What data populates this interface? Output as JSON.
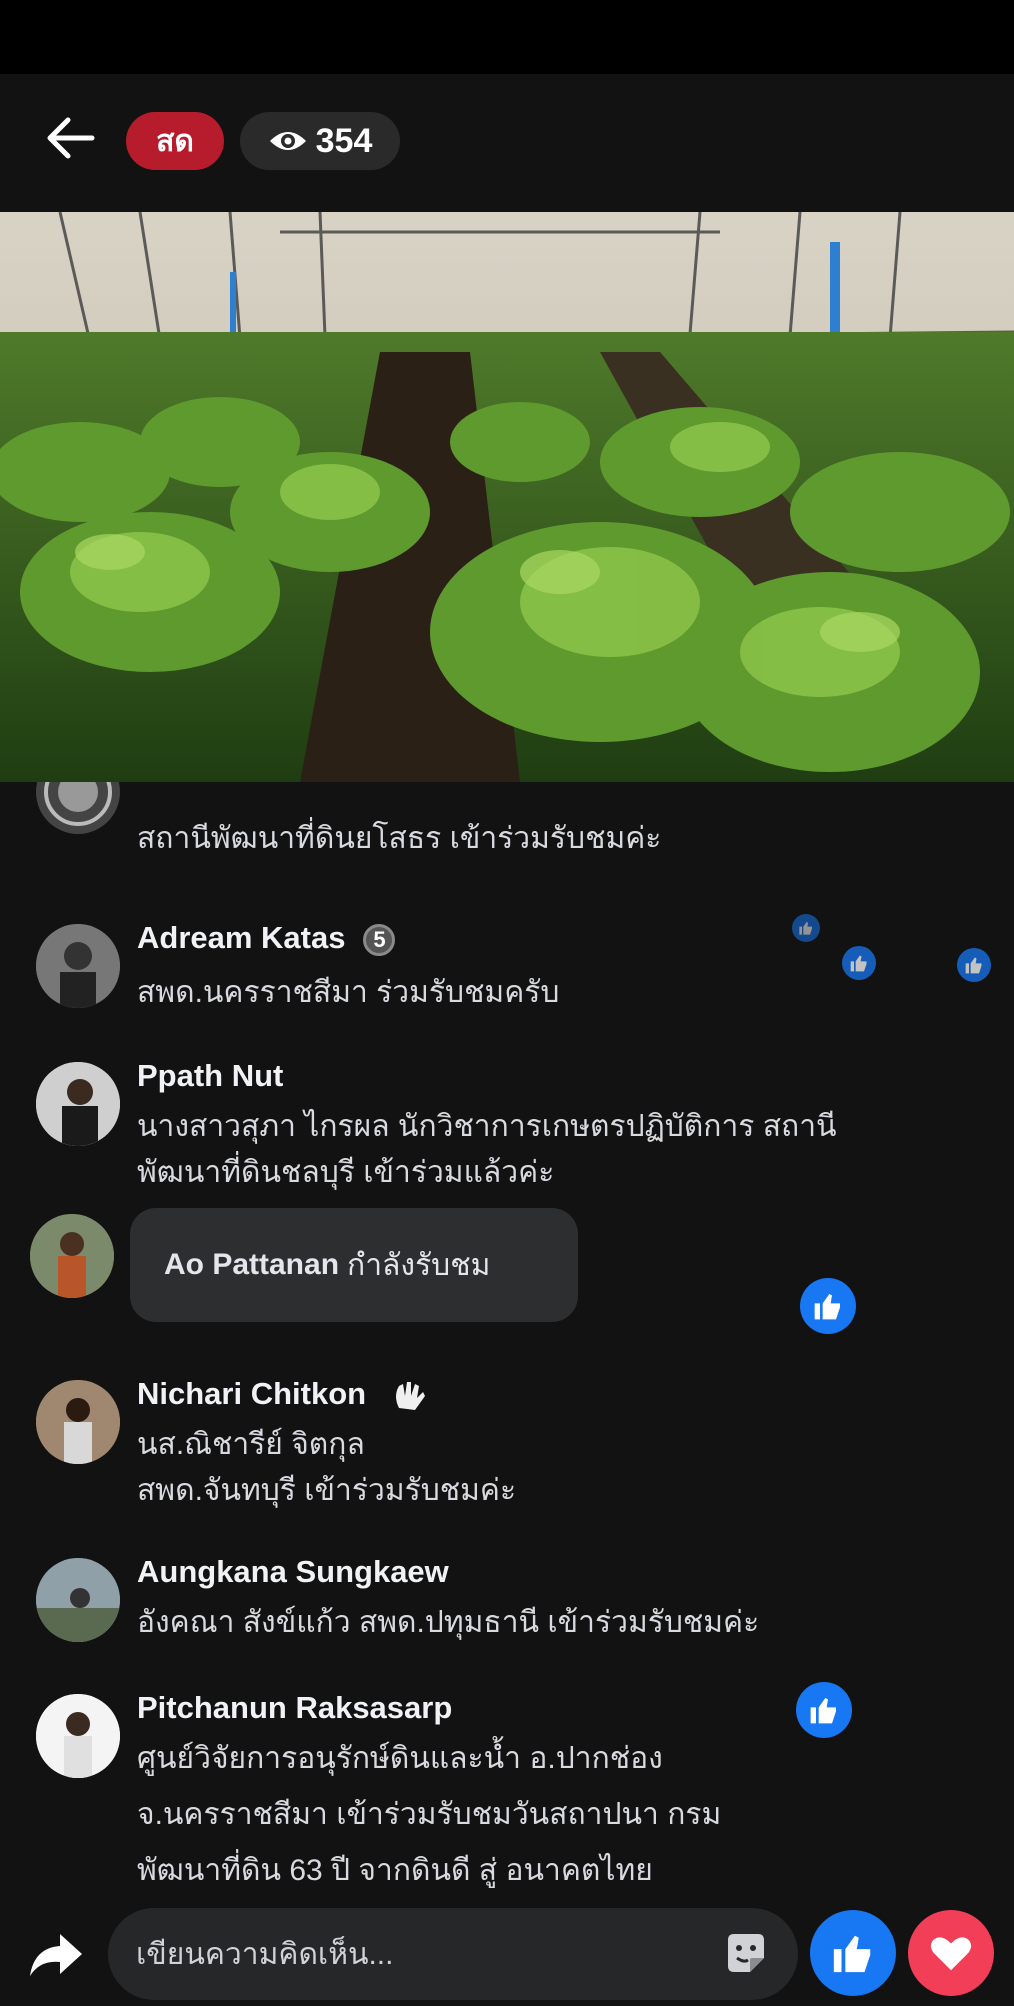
{
  "header": {
    "live_label": "สด",
    "viewer_count": "354"
  },
  "comments": [
    {
      "name": "",
      "text": "สถานีพัฒนาที่ดินยโสธร เข้าร่วมรับชมค่ะ"
    },
    {
      "name": "Adream Katas",
      "badge": "5",
      "text": "สพด.นครราชสีมา ร่วมรับชมครับ"
    },
    {
      "name": "Ppath Nut",
      "lines": [
        "นางสาวสุภา ไกรผล นักวิชาการเกษตรปฏิบัติการ สถานี",
        "พัฒนาที่ดินชลบุรี เข้าร่วมแล้วค่ะ"
      ]
    },
    {
      "name": "Ao Pattanan",
      "text": "กำลังรับชม"
    },
    {
      "name": "Nichari Chitkon",
      "lines": [
        "นส.ณิชารีย์  จิตกุล",
        "สพด.จันทบุรี  เข้าร่วมรับชมค่ะ"
      ]
    },
    {
      "name": "Aungkana Sungkaew",
      "text": "อังคณา สังข์แก้ว สพด.ปทุมธานี เข้าร่วมรับชมค่ะ"
    },
    {
      "name": "Pitchanun Raksasarp",
      "lines": [
        "ศูนย์วิจัยการอนุรักษ์ดินและน้ำ อ.ปากช่อง",
        "จ.นครราชสีมา เข้าร่วมรับชมวันสถาปนา กรม",
        "พัฒนาที่ดิน 63 ปี จากดินดี สู่ อนาคตไทย"
      ]
    }
  ],
  "composer": {
    "placeholder": "เขียนความคิดเห็น..."
  },
  "colors": {
    "live_red": "#b71c2c",
    "like_blue": "#1877f2",
    "heart_red": "#f33e58",
    "background": "#121212"
  },
  "icons": [
    "back-arrow-icon",
    "eye-icon",
    "thumbs-up-icon",
    "wave-icon",
    "share-icon",
    "sticker-icon",
    "heart-icon"
  ]
}
